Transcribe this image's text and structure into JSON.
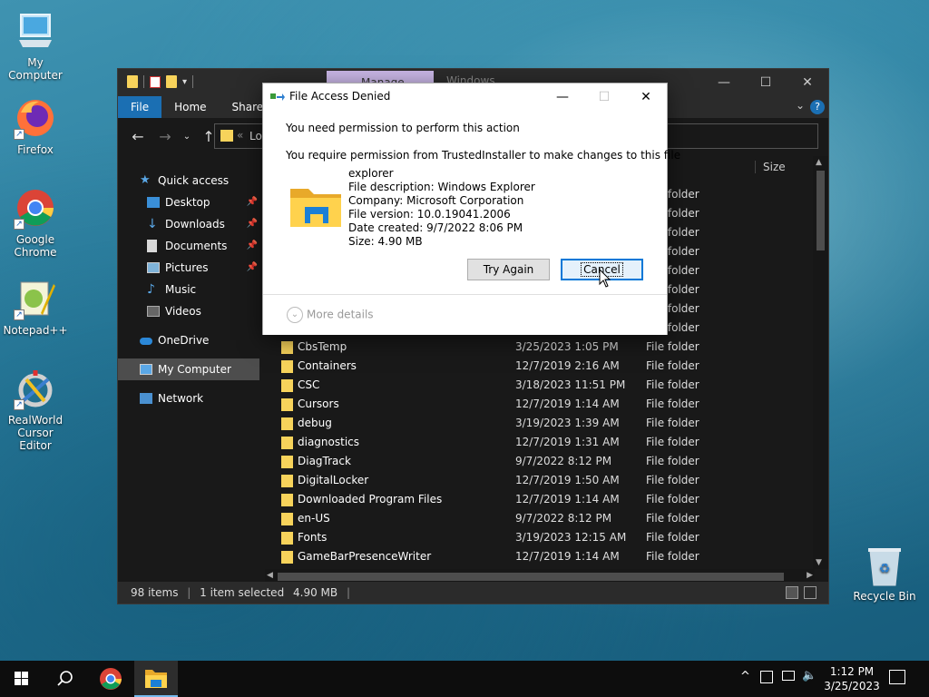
{
  "desktop": {
    "icons": [
      {
        "label": "My Computer"
      },
      {
        "label": "Firefox"
      },
      {
        "label": "Google Chrome"
      },
      {
        "label": "Notepad++"
      },
      {
        "label": "RealWorld Cursor Editor"
      }
    ],
    "recycle_bin": "Recycle Bin"
  },
  "explorer": {
    "title_tab_manage": "Manage",
    "title_tab_windows": "Windows",
    "ribbon_tabs": [
      "File",
      "Home",
      "Share"
    ],
    "address_text": "Lo",
    "nav_pane": {
      "quick_access": "Quick access",
      "desktop": "Desktop",
      "downloads": "Downloads",
      "documents": "Documents",
      "pictures": "Pictures",
      "music": "Music",
      "videos": "Videos",
      "onedrive": "OneDrive",
      "my_computer": "My Computer",
      "network": "Network"
    },
    "column_size": "Size",
    "partial_rows_type": "File folder",
    "rows": [
      {
        "name": "CbsTemp",
        "date": "3/25/2023 1:05 PM",
        "type": "File folder"
      },
      {
        "name": "Containers",
        "date": "12/7/2019 2:16 AM",
        "type": "File folder"
      },
      {
        "name": "CSC",
        "date": "3/18/2023 11:51 PM",
        "type": "File folder"
      },
      {
        "name": "Cursors",
        "date": "12/7/2019 1:14 AM",
        "type": "File folder"
      },
      {
        "name": "debug",
        "date": "3/19/2023 1:39 AM",
        "type": "File folder"
      },
      {
        "name": "diagnostics",
        "date": "12/7/2019 1:31 AM",
        "type": "File folder"
      },
      {
        "name": "DiagTrack",
        "date": "9/7/2022 8:12 PM",
        "type": "File folder"
      },
      {
        "name": "DigitalLocker",
        "date": "12/7/2019 1:50 AM",
        "type": "File folder"
      },
      {
        "name": "Downloaded Program Files",
        "date": "12/7/2019 1:14 AM",
        "type": "File folder"
      },
      {
        "name": "en-US",
        "date": "9/7/2022 8:12 PM",
        "type": "File folder"
      },
      {
        "name": "Fonts",
        "date": "3/19/2023 12:15 AM",
        "type": "File folder"
      },
      {
        "name": "GameBarPresenceWriter",
        "date": "12/7/2019 1:14 AM",
        "type": "File folder"
      }
    ],
    "status": {
      "items": "98 items",
      "selected": "1 item selected",
      "size": "4.90 MB"
    }
  },
  "dialog": {
    "title": "File Access Denied",
    "heading": "You need permission to perform this action",
    "message": "You require permission from TrustedInstaller to make changes to this file",
    "file_name": "explorer",
    "description": "File description: Windows Explorer",
    "company": "Company: Microsoft Corporation",
    "version": "File version: 10.0.19041.2006",
    "created": "Date created: 9/7/2022 8:06 PM",
    "size": "Size: 4.90 MB",
    "try_again": "Try Again",
    "cancel": "Cancel",
    "more_details": "More details"
  },
  "taskbar": {
    "time": "1:12 PM",
    "date": "3/25/2023"
  }
}
